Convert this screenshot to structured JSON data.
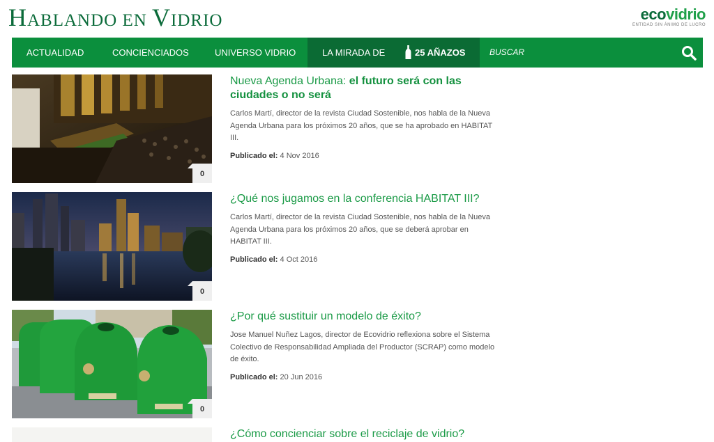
{
  "site": {
    "title_initial": "H",
    "title_rest": "ablando en ",
    "title_v": "V",
    "title_rest2": "idrio",
    "logo_eco": "eco",
    "logo_vidrio": "vidrio",
    "logo_tagline": "ENTIDAD SIN ÁNIMO DE LUCRO"
  },
  "nav": {
    "items": [
      "ACTUALIDAD",
      "CONCIENCIADOS",
      "UNIVERSO VIDRIO"
    ],
    "special_label": "LA MIRADA DE",
    "special_years": "25 AÑAZOS",
    "search_label": "BUSCAR"
  },
  "colors": {
    "brand_green": "#0b8f3d",
    "dark_green": "#0b6b34",
    "link_green": "#1a9a46"
  },
  "articles": [
    {
      "title_plain": "Nueva Agenda Urbana: ",
      "title_bold": "el futuro será con las ciudades o no será",
      "excerpt": "Carlos Martí, director de la revista Ciudad Sostenible, nos habla de la Nueva Agenda Urbana para los próximos 20 años, que se ha aprobado en HABITAT III.",
      "published_label": "Publicado el:",
      "date": "4 Nov 2016",
      "comments": "0"
    },
    {
      "title_plain": "¿Qué nos jugamos en la conferencia HABITAT III?",
      "title_bold": "",
      "excerpt": "Carlos Martí, director de la revista Ciudad Sostenible, nos habla de la Nueva Agenda Urbana para los próximos 20 años, que se deberá aprobar en HABITAT III.",
      "published_label": "Publicado el:",
      "date": "4 Oct 2016",
      "comments": "0"
    },
    {
      "title_plain": "¿Por qué sustituir un modelo de éxito?",
      "title_bold": "",
      "excerpt": "Jose Manuel Nuñez Lagos, director de Ecovidrio reflexiona sobre el Sistema Colectivo de Responsabilidad Ampliada del Productor (SCRAP) como modelo de éxito.",
      "published_label": "Publicado el:",
      "date": "20 Jun 2016",
      "comments": "0"
    },
    {
      "title_plain": "¿Cómo concienciar sobre el reciclaje de vidrio?",
      "title_bold": "",
      "excerpt": "",
      "published_label": "",
      "date": "",
      "comments": ""
    }
  ]
}
